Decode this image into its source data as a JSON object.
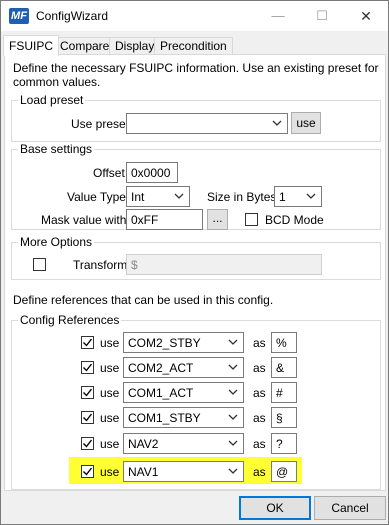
{
  "window": {
    "title": "ConfigWizard",
    "icon_text": "MF",
    "controls": {
      "minimize": "—",
      "maximize": "☐",
      "close": "✕"
    }
  },
  "tabs": [
    {
      "label": "FSUIPC",
      "active": true
    },
    {
      "label": "Compare",
      "active": false
    },
    {
      "label": "Display",
      "active": false
    },
    {
      "label": "Precondition",
      "active": false
    }
  ],
  "intro": "Define the necessary FSUIPC information. Use an existing preset for common values.",
  "load_preset": {
    "legend": "Load preset",
    "label": "Use preset",
    "value": "",
    "button": "use"
  },
  "base_settings": {
    "legend": "Base settings",
    "offset_label": "Offset",
    "offset_value": "0x0000",
    "value_type_label": "Value Type",
    "value_type": "Int",
    "size_label": "Size in Bytes",
    "size_value": "1",
    "mask_label": "Mask value with",
    "mask_value": "0xFF",
    "mask_button": "...",
    "bcd_label": "BCD Mode",
    "bcd_checked": false
  },
  "more_options": {
    "legend": "More Options",
    "transform_label": "Transform",
    "transform_checked": false,
    "transform_value": "$"
  },
  "references_intro": "Define references that can be used in this config.",
  "config_references": {
    "legend": "Config References",
    "rows": [
      {
        "use_label": "use",
        "checked": true,
        "ref": "COM2_STBY",
        "as_label": "as",
        "placeholder": "%"
      },
      {
        "use_label": "use",
        "checked": true,
        "ref": "COM2_ACT",
        "as_label": "as",
        "placeholder": "&"
      },
      {
        "use_label": "use",
        "checked": true,
        "ref": "COM1_ACT",
        "as_label": "as",
        "placeholder": "#"
      },
      {
        "use_label": "use",
        "checked": true,
        "ref": "COM1_STBY",
        "as_label": "as",
        "placeholder": "§"
      },
      {
        "use_label": "use",
        "checked": true,
        "ref": "NAV2",
        "as_label": "as",
        "placeholder": "?"
      },
      {
        "use_label": "use",
        "checked": true,
        "ref": "NAV1",
        "as_label": "as",
        "placeholder": "@",
        "highlighted": true
      }
    ]
  },
  "footer": {
    "ok": "OK",
    "cancel": "Cancel"
  },
  "colors": {
    "highlight": "#ffff33",
    "accent": "#0078d7",
    "icon_bg": "#1f5fb3"
  }
}
